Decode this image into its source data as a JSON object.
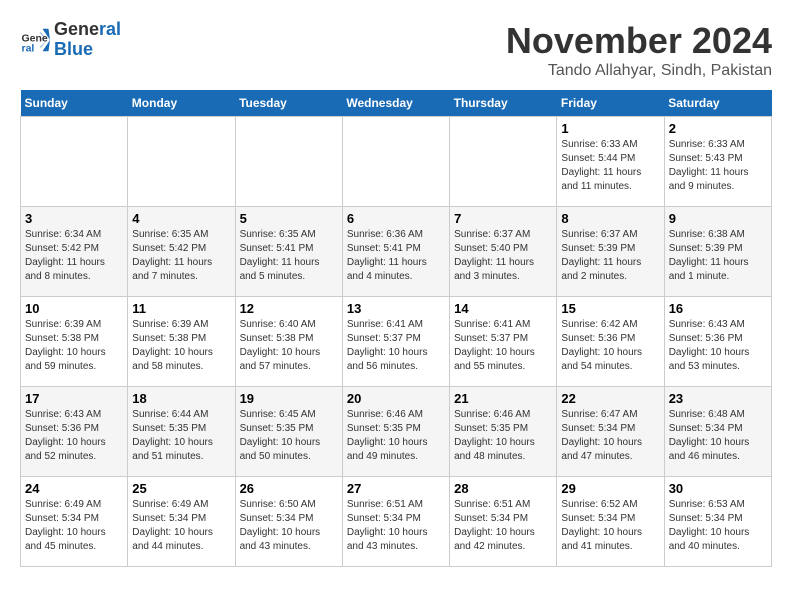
{
  "logo": {
    "line1": "General",
    "line2": "Blue"
  },
  "title": "November 2024",
  "location": "Tando Allahyar, Sindh, Pakistan",
  "days_of_week": [
    "Sunday",
    "Monday",
    "Tuesday",
    "Wednesday",
    "Thursday",
    "Friday",
    "Saturday"
  ],
  "weeks": [
    [
      {
        "day": "",
        "info": ""
      },
      {
        "day": "",
        "info": ""
      },
      {
        "day": "",
        "info": ""
      },
      {
        "day": "",
        "info": ""
      },
      {
        "day": "",
        "info": ""
      },
      {
        "day": "1",
        "info": "Sunrise: 6:33 AM\nSunset: 5:44 PM\nDaylight: 11 hours and 11 minutes."
      },
      {
        "day": "2",
        "info": "Sunrise: 6:33 AM\nSunset: 5:43 PM\nDaylight: 11 hours and 9 minutes."
      }
    ],
    [
      {
        "day": "3",
        "info": "Sunrise: 6:34 AM\nSunset: 5:42 PM\nDaylight: 11 hours and 8 minutes."
      },
      {
        "day": "4",
        "info": "Sunrise: 6:35 AM\nSunset: 5:42 PM\nDaylight: 11 hours and 7 minutes."
      },
      {
        "day": "5",
        "info": "Sunrise: 6:35 AM\nSunset: 5:41 PM\nDaylight: 11 hours and 5 minutes."
      },
      {
        "day": "6",
        "info": "Sunrise: 6:36 AM\nSunset: 5:41 PM\nDaylight: 11 hours and 4 minutes."
      },
      {
        "day": "7",
        "info": "Sunrise: 6:37 AM\nSunset: 5:40 PM\nDaylight: 11 hours and 3 minutes."
      },
      {
        "day": "8",
        "info": "Sunrise: 6:37 AM\nSunset: 5:39 PM\nDaylight: 11 hours and 2 minutes."
      },
      {
        "day": "9",
        "info": "Sunrise: 6:38 AM\nSunset: 5:39 PM\nDaylight: 11 hours and 1 minute."
      }
    ],
    [
      {
        "day": "10",
        "info": "Sunrise: 6:39 AM\nSunset: 5:38 PM\nDaylight: 10 hours and 59 minutes."
      },
      {
        "day": "11",
        "info": "Sunrise: 6:39 AM\nSunset: 5:38 PM\nDaylight: 10 hours and 58 minutes."
      },
      {
        "day": "12",
        "info": "Sunrise: 6:40 AM\nSunset: 5:38 PM\nDaylight: 10 hours and 57 minutes."
      },
      {
        "day": "13",
        "info": "Sunrise: 6:41 AM\nSunset: 5:37 PM\nDaylight: 10 hours and 56 minutes."
      },
      {
        "day": "14",
        "info": "Sunrise: 6:41 AM\nSunset: 5:37 PM\nDaylight: 10 hours and 55 minutes."
      },
      {
        "day": "15",
        "info": "Sunrise: 6:42 AM\nSunset: 5:36 PM\nDaylight: 10 hours and 54 minutes."
      },
      {
        "day": "16",
        "info": "Sunrise: 6:43 AM\nSunset: 5:36 PM\nDaylight: 10 hours and 53 minutes."
      }
    ],
    [
      {
        "day": "17",
        "info": "Sunrise: 6:43 AM\nSunset: 5:36 PM\nDaylight: 10 hours and 52 minutes."
      },
      {
        "day": "18",
        "info": "Sunrise: 6:44 AM\nSunset: 5:35 PM\nDaylight: 10 hours and 51 minutes."
      },
      {
        "day": "19",
        "info": "Sunrise: 6:45 AM\nSunset: 5:35 PM\nDaylight: 10 hours and 50 minutes."
      },
      {
        "day": "20",
        "info": "Sunrise: 6:46 AM\nSunset: 5:35 PM\nDaylight: 10 hours and 49 minutes."
      },
      {
        "day": "21",
        "info": "Sunrise: 6:46 AM\nSunset: 5:35 PM\nDaylight: 10 hours and 48 minutes."
      },
      {
        "day": "22",
        "info": "Sunrise: 6:47 AM\nSunset: 5:34 PM\nDaylight: 10 hours and 47 minutes."
      },
      {
        "day": "23",
        "info": "Sunrise: 6:48 AM\nSunset: 5:34 PM\nDaylight: 10 hours and 46 minutes."
      }
    ],
    [
      {
        "day": "24",
        "info": "Sunrise: 6:49 AM\nSunset: 5:34 PM\nDaylight: 10 hours and 45 minutes."
      },
      {
        "day": "25",
        "info": "Sunrise: 6:49 AM\nSunset: 5:34 PM\nDaylight: 10 hours and 44 minutes."
      },
      {
        "day": "26",
        "info": "Sunrise: 6:50 AM\nSunset: 5:34 PM\nDaylight: 10 hours and 43 minutes."
      },
      {
        "day": "27",
        "info": "Sunrise: 6:51 AM\nSunset: 5:34 PM\nDaylight: 10 hours and 43 minutes."
      },
      {
        "day": "28",
        "info": "Sunrise: 6:51 AM\nSunset: 5:34 PM\nDaylight: 10 hours and 42 minutes."
      },
      {
        "day": "29",
        "info": "Sunrise: 6:52 AM\nSunset: 5:34 PM\nDaylight: 10 hours and 41 minutes."
      },
      {
        "day": "30",
        "info": "Sunrise: 6:53 AM\nSunset: 5:34 PM\nDaylight: 10 hours and 40 minutes."
      }
    ]
  ]
}
